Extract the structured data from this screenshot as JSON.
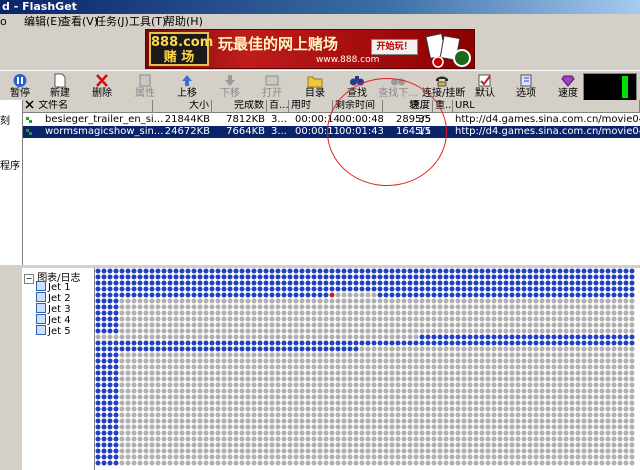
{
  "window": {
    "title": "d - FlashGet"
  },
  "menu": {
    "items": [
      "编辑(E)",
      "查看(V)",
      "任务(J)",
      "工具(T)",
      "帮助(H)"
    ],
    "first_fragment": "o"
  },
  "banner": {
    "logo": "888.com\n赌 场",
    "slogan": "玩最佳的网上赌场",
    "play": "开始玩！",
    "url": "www.888.com"
  },
  "toolbar": {
    "pause": "暂停",
    "new": "新建",
    "delete": "删除",
    "properties": "属性",
    "move_up": "上移",
    "move_down": "下移",
    "open": "打开",
    "directory": "目录",
    "find": "查找",
    "find_next": "查找下...",
    "connect": "连接/挂断",
    "default": "默认",
    "options": "选项",
    "speed": "速度"
  },
  "left_strip": {
    "label_top": "刻",
    "label_mid": "程序"
  },
  "list": {
    "columns": [
      "文件名",
      "大小",
      "完成数",
      "百...",
      "用时",
      "剩余时间",
      "速度",
      "块...",
      "重...",
      "URL"
    ],
    "rows": [
      {
        "name": "besieger_trailer_en_si...",
        "size": "21844KB",
        "done": "7812KB",
        "pct": "3...",
        "elapsed": "00:00:14",
        "remaining": "00:00:48",
        "speed": "289.35",
        "blocks": "5/5",
        "retry": "",
        "url": "http://d4.games.sina.com.cn/movie040214/besieger_",
        "status_color": "#2a9a2a",
        "selected": false
      },
      {
        "name": "wormsmagicshow_sin...",
        "size": "24672KB",
        "done": "7664KB",
        "pct": "3...",
        "elapsed": "00:00:11",
        "remaining": "00:01:43",
        "speed": "164.11",
        "blocks": "5/5",
        "retry": "",
        "url": "http://d4.games.sina.com.cn/movie040214/wormsmag",
        "status_color": "#2a9a2a",
        "selected": true
      }
    ]
  },
  "tree": {
    "root": "图表/日志",
    "items": [
      "Jet 1",
      "Jet 2",
      "Jet 3",
      "Jet 4",
      "Jet 5"
    ]
  },
  "colors": {
    "block_done": "#2040c0",
    "block_todo": "#b0b0b0",
    "block_active": "#c02020",
    "selection": "#0a246a"
  }
}
